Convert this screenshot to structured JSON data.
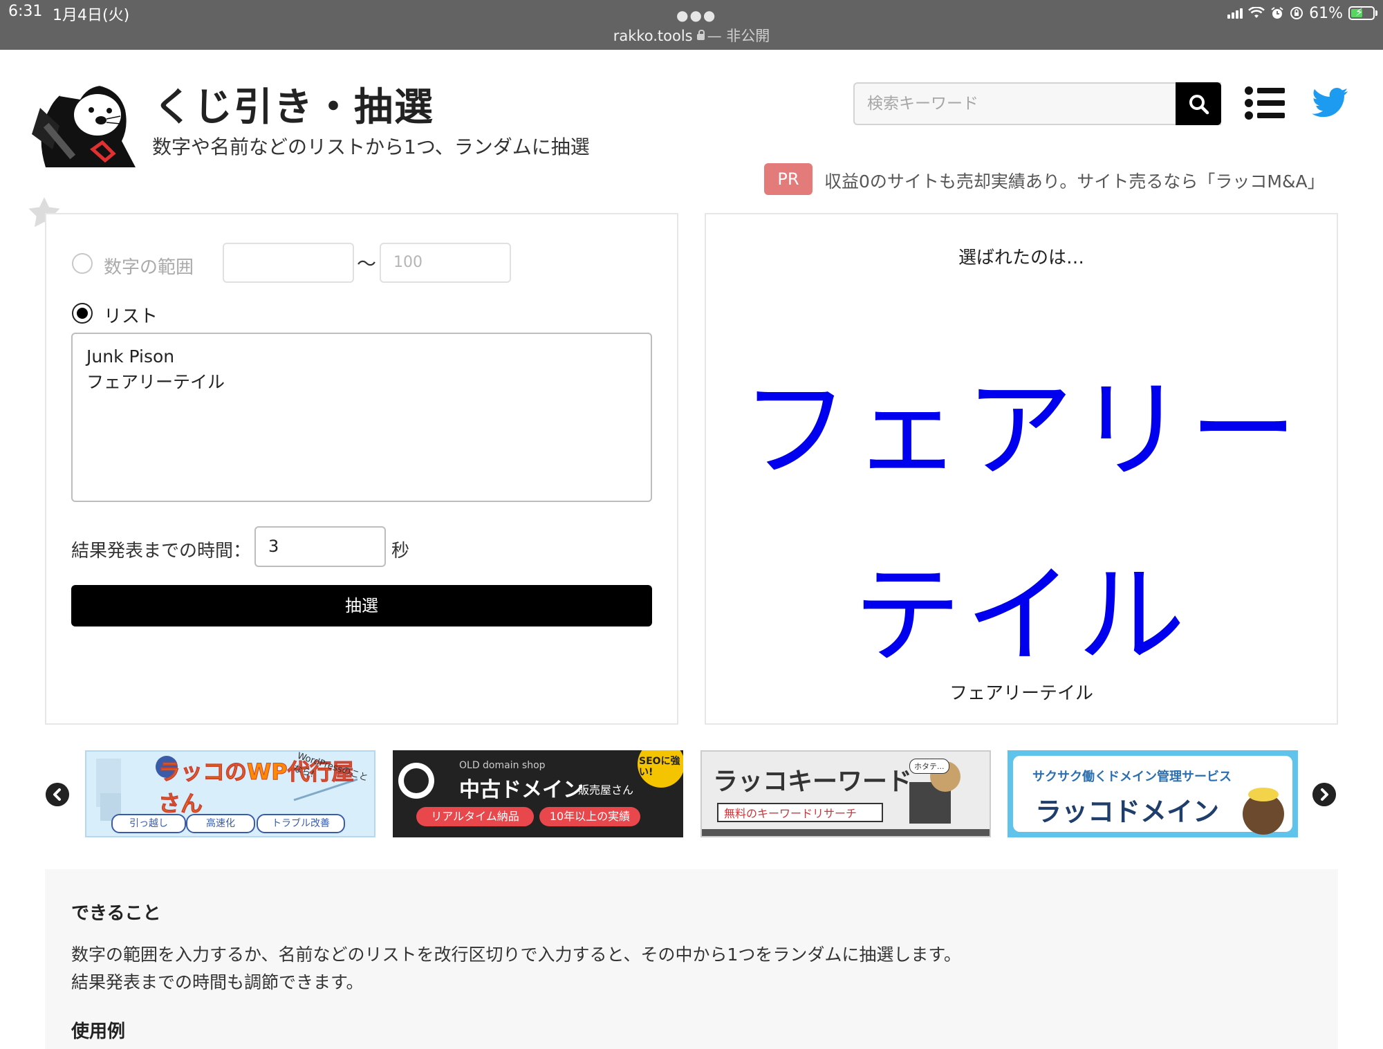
{
  "status_bar": {
    "time": "6:31",
    "date": "1月4日(火)",
    "url": "rakko.tools",
    "privacy": "— 非公開",
    "battery": "61%",
    "battery_level": 0.61
  },
  "header": {
    "title": "くじ引き・抽選",
    "subtitle": "数字や名前などのリストから1つ、ランダムに抽選",
    "search_placeholder": "検索キーワード",
    "pr_badge": "PR",
    "pr_text": "収益0のサイトも売却実績あり。サイト売るなら「ラッコM&A」"
  },
  "form": {
    "range_label": "数字の範囲",
    "range_tilde": "〜",
    "range_min": "",
    "range_max_placeholder": "100",
    "list_label": "リスト",
    "list_items": [
      "Junk Pison",
      "フェアリーテイル"
    ],
    "time_label": "結果発表までの時間：",
    "time_value": "3",
    "time_unit": "秒",
    "draw_button": "抽選"
  },
  "result": {
    "heading": "選ばれたのは…",
    "big_line1": "フェアリー",
    "big_line2": "テイル",
    "small": "フェアリーテイル"
  },
  "banners": {
    "wp": {
      "title": "ラッコのWP代行屋さん",
      "note": "WordPressのことなら!",
      "tags": [
        "引っ越し",
        "高速化",
        "トラブル改善"
      ]
    },
    "domain": {
      "top": "OLD domain shop",
      "title": "中古ドメイン",
      "suffix": "販売屋さん",
      "badge": "SEOに強い!",
      "tag1": "リアルタイム納品",
      "tag2": "10年以上の実績"
    },
    "keyword": {
      "title": "ラッコキーワード",
      "sub": "無料のキーワードリサーチ",
      "bubble": "ホタテ..."
    },
    "rakko_domain": {
      "top": "サクサク働くドメイン管理サービス",
      "title": "ラッコドメイン"
    }
  },
  "info": {
    "heading": "できること",
    "line1": "数字の範囲を入力するか、名前などのリストを改行区切りで入力すると、その中から1つをランダムに抽選します。",
    "line2": "結果発表までの時間も調節できます。",
    "usage_heading": "使用例"
  },
  "colors": {
    "result_text": "#0000ee",
    "pr_badge": "#e37b7b",
    "twitter": "#1d9bf0",
    "status_bar": "#636363"
  },
  "icons": [
    "search-icon",
    "menu-icon",
    "twitter-icon",
    "star-icon",
    "chevron-left-icon",
    "chevron-right-icon",
    "lock-icon",
    "wifi-icon",
    "alarm-icon",
    "battery-icon"
  ]
}
